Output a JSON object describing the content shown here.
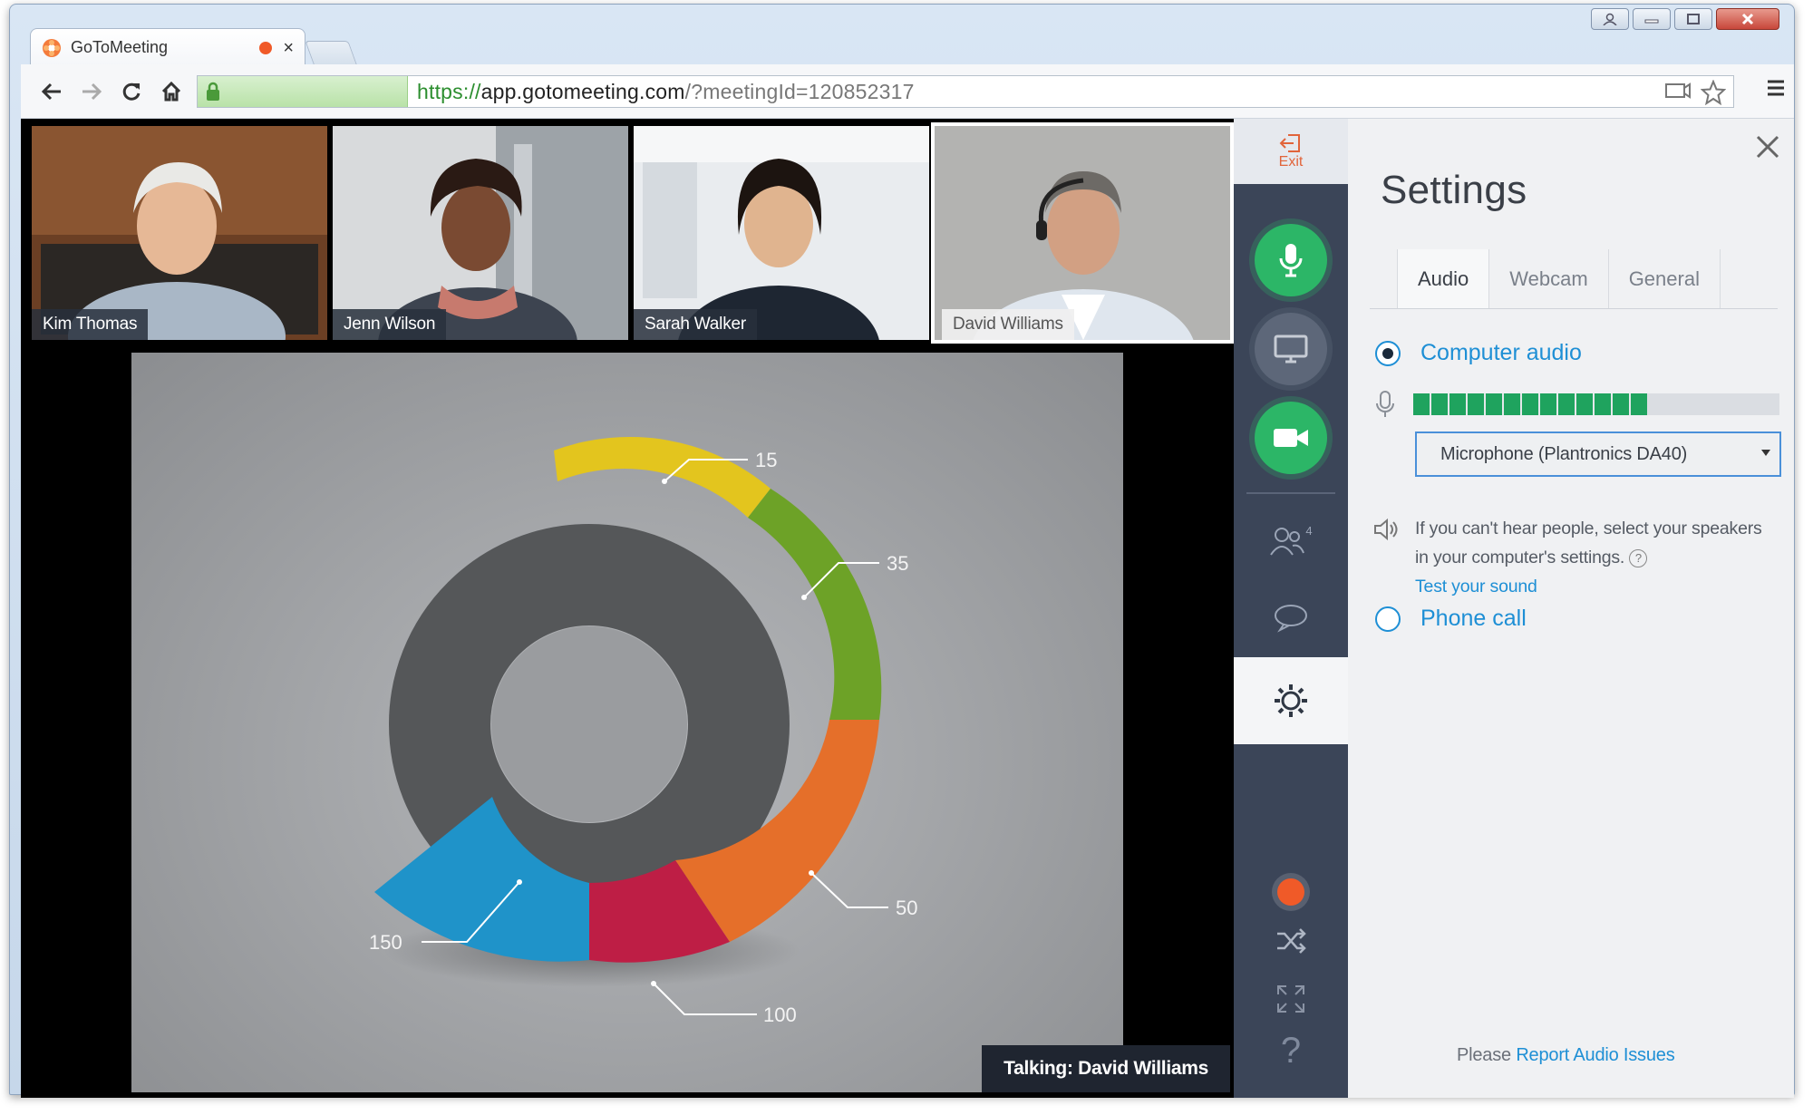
{
  "browser": {
    "tab_title": "GoToMeeting",
    "tab_close": "×",
    "url_scheme": "https://",
    "url_host": "app.gotomeeting.com",
    "url_path": "/?meetingId=120852317"
  },
  "participants": [
    {
      "name": "Kim Thomas"
    },
    {
      "name": "Jenn Wilson"
    },
    {
      "name": "Sarah Walker"
    },
    {
      "name": "David Williams"
    }
  ],
  "share": {
    "talking_label": "Talking: David Williams"
  },
  "rail": {
    "exit_label": "Exit",
    "participant_count": "4",
    "help_glyph": "?"
  },
  "settings": {
    "title": "Settings",
    "tabs": [
      "Audio",
      "Webcam",
      "General"
    ],
    "computer_audio_label": "Computer audio",
    "mic_level": 0.77,
    "mic_level_segments": 13,
    "microphone_selected": "Microphone (Plantronics DA40)",
    "speaker_hint": "If you can't hear people, select your speakers in your computer's settings.",
    "test_sound_link": "Test your sound",
    "phone_call_label": "Phone call",
    "report_prefix": "Please",
    "report_link": "Report Audio Issues"
  },
  "colors": {
    "accent_blue": "#1e8fd5",
    "green": "#2cb667",
    "rail": "#3b4558",
    "record": "#f05a28"
  }
}
